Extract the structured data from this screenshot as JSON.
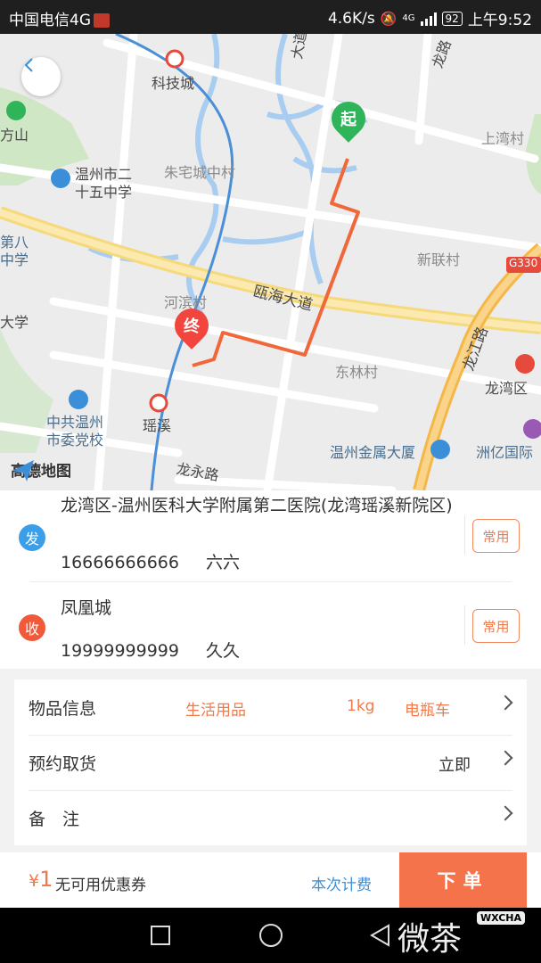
{
  "status_bar": {
    "carrier": "中国电信4G",
    "speed": "4.6K/s",
    "network": "4G",
    "battery": "92",
    "time": "上午9:52"
  },
  "map": {
    "labels": {
      "kejicheng": "科技城",
      "fangshan": "方山",
      "school25": "温州市二",
      "school25b": "十五中学",
      "zhuzhai": "朱宅城中村",
      "shangwan": "上湾村",
      "xinlian": "新联村",
      "g330": "G330",
      "ouhai": "瓯海大道",
      "heyu": "河滨村",
      "dalin": "东林村",
      "longjiang": "龙江路",
      "longwan_dist": "龙湾区",
      "yaoxi": "瑶溪",
      "party1": "中共温州",
      "party2": "市委党校",
      "jinshu": "温州金属大厦",
      "zhouyi": "洲亿国际",
      "longyong": "龙永路",
      "dadao_top": "大道",
      "longlu_top": "龙路",
      "school8a": "第八",
      "school8b": "中学",
      "daxue": "大学"
    },
    "start_pin": "起",
    "end_pin": "终",
    "logo_text": "高德地图",
    "colors": {
      "route": "#f0683a",
      "metro": "#4a8fd8",
      "start": "#2fb45a",
      "end": "#f2453d"
    }
  },
  "sender": {
    "badge": "发",
    "address": "龙湾区-温州医科大学附属第二医院(龙湾瑶溪新院区)",
    "phone": "16666666666",
    "name": "六六",
    "common_label": "常用"
  },
  "receiver": {
    "badge": "收",
    "address": "凤凰城",
    "phone": "19999999999",
    "name": "久久",
    "common_label": "常用"
  },
  "info": {
    "goods_label": "物品信息",
    "goods_type": "生活用品",
    "goods_weight": "1kg",
    "goods_vehicle": "电瓶车",
    "pickup_label": "预约取货",
    "pickup_value": "立即",
    "note_label": "备　注"
  },
  "footer": {
    "currency": "¥",
    "price": "1",
    "coupon": "无可用优惠券",
    "fee_label": "本次计费",
    "order_label": "下单"
  },
  "watermark": {
    "text": "微茶",
    "tag": "WXCHA"
  }
}
